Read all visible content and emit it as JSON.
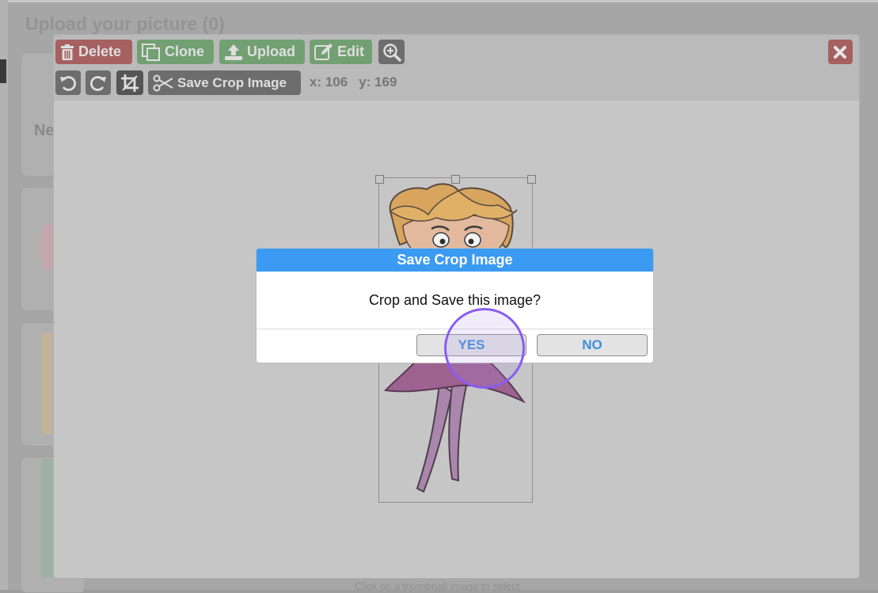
{
  "background": {
    "title": "Upload your picture (0)",
    "card_text": "Ne",
    "footer": "Click on a thumbnail image to select"
  },
  "toolbar": {
    "delete_label": "Delete",
    "clone_label": "Clone",
    "upload_label": "Upload",
    "edit_label": "Edit",
    "save_crop_label": "Save Crop Image",
    "coord_x": "x: 106",
    "coord_y": "y: 169"
  },
  "dialog": {
    "title": "Save Crop Image",
    "message": "Crop and Save this image?",
    "yes_label": "YES",
    "no_label": "NO"
  },
  "colors": {
    "dialog_header": "#3b9af2",
    "dialog_button_text": "#3d8fdf",
    "delete_button": "#a66060",
    "green_buttons": "#72a072",
    "click_indicator": "#8a5cf0"
  },
  "icons": [
    "trash-icon",
    "clone-icon",
    "upload-icon",
    "edit-icon",
    "zoom-in-icon",
    "undo-icon",
    "redo-icon",
    "crop-icon",
    "scissors-icon",
    "close-icon"
  ]
}
